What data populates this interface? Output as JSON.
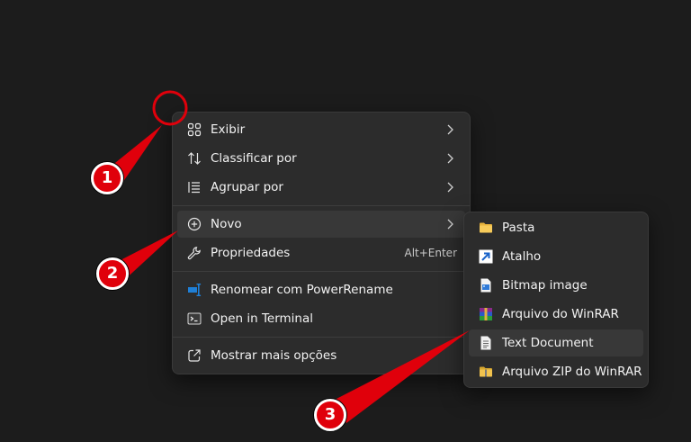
{
  "main_menu": {
    "items": [
      {
        "label": "Exibir",
        "icon": "grid-icon",
        "submenu": true
      },
      {
        "label": "Classificar por",
        "icon": "sort-icon",
        "submenu": true
      },
      {
        "label": "Agrupar por",
        "icon": "group-list-icon",
        "submenu": true
      },
      {
        "label": "Novo",
        "icon": "plus-circle-icon",
        "submenu": true
      },
      {
        "label": "Propriedades",
        "icon": "wrench-icon",
        "shortcut": "Alt+Enter"
      },
      {
        "label": "Renomear com PowerRename",
        "icon": "powerrename-icon"
      },
      {
        "label": "Open in Terminal",
        "icon": "terminal-icon"
      },
      {
        "label": "Mostrar mais opções",
        "icon": "share-more-icon"
      }
    ]
  },
  "sub_menu": {
    "items": [
      {
        "label": "Pasta",
        "icon": "folder-icon"
      },
      {
        "label": "Atalho",
        "icon": "shortcut-arrow-icon"
      },
      {
        "label": "Bitmap image",
        "icon": "bitmap-file-icon"
      },
      {
        "label": "Arquivo do WinRAR",
        "icon": "winrar-icon"
      },
      {
        "label": "Text Document",
        "icon": "text-document-icon"
      },
      {
        "label": "Arquivo ZIP do WinRAR",
        "icon": "zip-folder-icon"
      }
    ]
  },
  "annotations": {
    "badges": [
      "1",
      "2",
      "3"
    ]
  },
  "colors": {
    "background": "#1c1c1c",
    "menu": "#2c2c2c",
    "highlight": "#383838",
    "annotation_red": "#e0000b"
  }
}
